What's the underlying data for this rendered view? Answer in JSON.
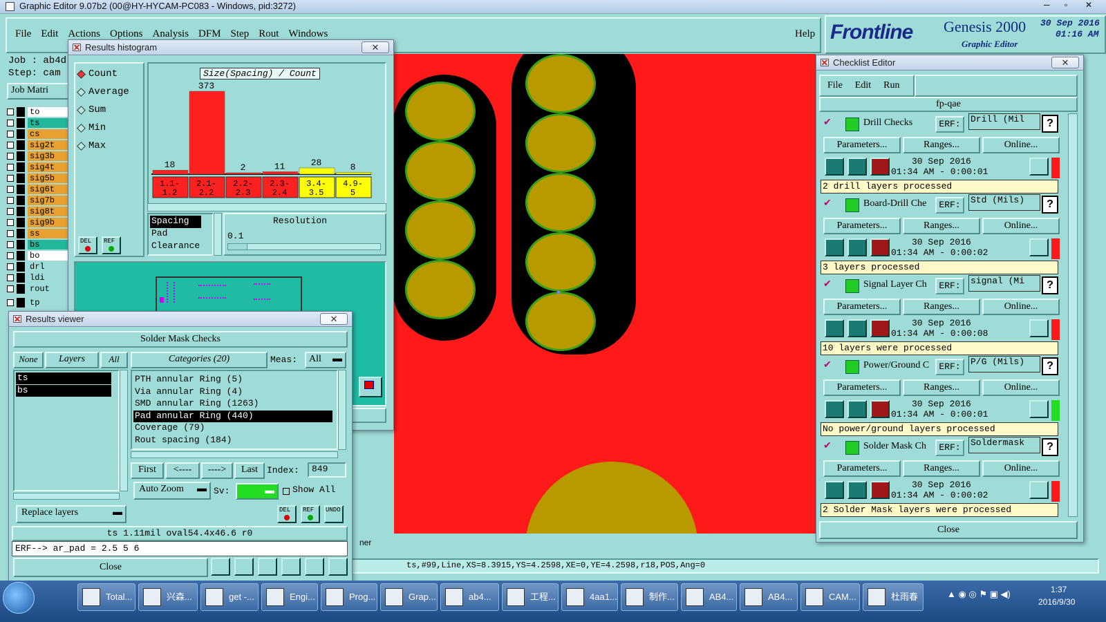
{
  "window_title": "Graphic Editor 9.07b2 (00@HY-HYCAM-PC083 - Windows, pid:3272)",
  "menu": [
    "File",
    "Edit",
    "Actions",
    "Options",
    "Analysis",
    "DFM",
    "Step",
    "Rout",
    "Windows"
  ],
  "help": "Help",
  "brand": {
    "logo": "Frontline",
    "product": "Genesis 2000",
    "sub": "Graphic Editor",
    "date": "30 Sep 2016",
    "time": "01:16 AM"
  },
  "left_panel": {
    "job": "Job : ab4d",
    "step": "Step: cam",
    "matrix": "Job Matri",
    "layers": [
      {
        "name": "to",
        "color": "#ffffff"
      },
      {
        "name": "ts",
        "color": "#21b79a"
      },
      {
        "name": "cs",
        "color": "#e8a030"
      },
      {
        "name": "sig2t",
        "color": "#e8a030"
      },
      {
        "name": "sig3b",
        "color": "#e8a030"
      },
      {
        "name": "sig4t",
        "color": "#e8a030"
      },
      {
        "name": "sig5b",
        "color": "#e8a030"
      },
      {
        "name": "sig6t",
        "color": "#e8a030"
      },
      {
        "name": "sig7b",
        "color": "#e8a030"
      },
      {
        "name": "sig8t",
        "color": "#e8a030"
      },
      {
        "name": "sig9b",
        "color": "#e8a030"
      },
      {
        "name": "ss",
        "color": "#e8a030"
      },
      {
        "name": "bs",
        "color": "#21b79a"
      },
      {
        "name": "bo",
        "color": "#ffffff"
      }
    ],
    "layers2": [
      "drl",
      "ldi",
      "rout"
    ],
    "layers3": [
      "tp"
    ]
  },
  "histogram": {
    "title": "Results histogram",
    "options": [
      "Count",
      "Average",
      "Sum",
      "Min",
      "Max"
    ],
    "selected": "Count",
    "chart_title": "Size(Spacing) / Count",
    "del": "DEL",
    "ref": "REF",
    "measures": [
      "Spacing",
      "Pad",
      "Clearance"
    ],
    "resolution_label": "Resolution",
    "resolution_value": "0.1"
  },
  "chart_data": {
    "type": "bar",
    "title": "Size(Spacing) / Count",
    "categories": [
      "1.1-1.2",
      "2.1-2.2",
      "2.2-2.3",
      "2.3-2.4",
      "3.4-3.5",
      "4.9-5"
    ],
    "values": [
      18,
      373,
      2,
      11,
      28,
      8
    ],
    "colors": [
      "#ff2020",
      "#ff2020",
      "#ff2020",
      "#ff2020",
      "#ffff00",
      "#ffff00"
    ]
  },
  "results_viewer": {
    "title": "Results viewer",
    "header": "Solder Mask Checks",
    "none": "None",
    "layers": "Layers",
    "all": "All",
    "categories": "Categories (20)",
    "meas_label": "Meas:",
    "meas_value": "All",
    "layer_list": [
      "ts",
      "bs"
    ],
    "category_list": [
      "PTH annular Ring (5)",
      "Via annular Ring (4)",
      "SMD annular Ring (1263)",
      "Pad annular Ring (440)",
      "Coverage (79)",
      "Rout spacing (184)"
    ],
    "selected_category": "Pad annular Ring (440)",
    "first": "First",
    "prev": "<----",
    "next": "---->",
    "last": "Last",
    "index_label": "Index:",
    "index_value": "849",
    "zoom": "Auto Zoom",
    "sv": "Sv:",
    "show_all": "Show All",
    "replace": "Replace layers",
    "info": "ts 1.11mil   oval54.4x46.6  r0",
    "erf": "ERF--> ar_pad = 2.5 5 6",
    "close": "Close",
    "undo": "UNDO"
  },
  "status_bar": "ts,#99,Line,XS=8.3915,YS=4.2598,XE=0,YE=4.2598,r18,POS,Ang=0",
  "status_partial": "ner",
  "checklist": {
    "title": "Checklist Editor",
    "menu": [
      "File",
      "Edit",
      "Run"
    ],
    "name": "fp-qae",
    "erf": "ERF:",
    "params": "Parameters...",
    "ranges": "Ranges...",
    "online": "Online...",
    "items": [
      {
        "name": "Drill Checks",
        "erf": "Drill (Mil",
        "date": "30 Sep 2016",
        "time": "01:34 AM - 0:00:01",
        "result": "2 drill layers processed",
        "status": "#ff1a1a"
      },
      {
        "name": "Board-Drill Che",
        "erf": "Std (Mils)",
        "date": "30 Sep 2016",
        "time": "01:34 AM - 0:00:02",
        "result": "3 layers processed",
        "status": "#ff1a1a"
      },
      {
        "name": "Signal Layer Ch",
        "erf": "signal (Mi",
        "date": "30 Sep 2016",
        "time": "01:34 AM - 0:00:08",
        "result": "10 layers were processed",
        "status": "#ff1a1a"
      },
      {
        "name": "Power/Ground C",
        "erf": "P/G (Mils)",
        "date": "30 Sep 2016",
        "time": "01:34 AM - 0:00:01",
        "result": "No power/ground layers processed",
        "status": "#22dd22"
      },
      {
        "name": "Solder Mask Ch",
        "erf": "Soldermask",
        "date": "30 Sep 2016",
        "time": "01:34 AM - 0:00:02",
        "result": "2 Solder Mask layers were processed",
        "status": "#ff1a1a"
      }
    ],
    "close": "Close"
  },
  "taskbar": {
    "items": [
      "Total...",
      "兴森...",
      "get -...",
      "Engi...",
      "Prog...",
      "Grap...",
      "ab4...",
      "工程...",
      "4aa1...",
      "制作...",
      "AB4...",
      "AB4...",
      "CAM...",
      "杜雨春"
    ],
    "time": "1:37",
    "date": "2016/9/30"
  }
}
